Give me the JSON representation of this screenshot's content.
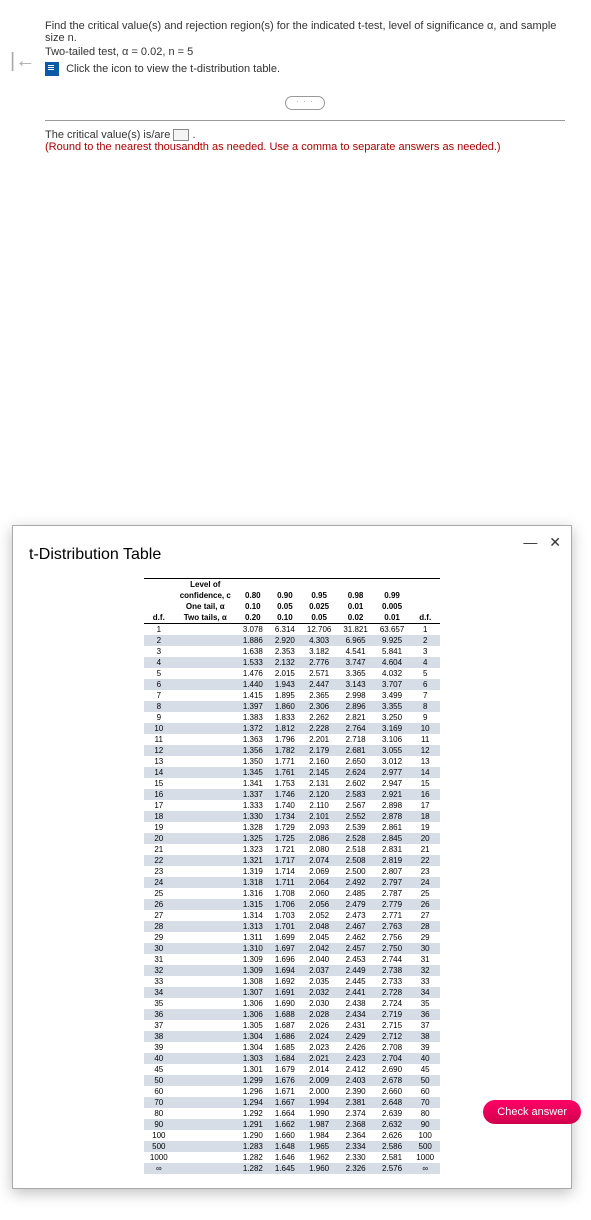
{
  "top": {
    "prompt": "Find the critical value(s) and rejection region(s) for the indicated t-test, level of significance α, and sample size n.",
    "test_line": "Two-tailed test, α = 0.02, n = 5",
    "link_text": "Click the icon to view the t-distribution table."
  },
  "answer": {
    "line1_a": "The critical value(s) is/are ",
    "line1_b": ".",
    "hint": "(Round to the nearest thousandth as needed. Use a comma to separate answers as needed.)"
  },
  "modal": {
    "title": "t-Distribution Table",
    "group_label": "Level of",
    "hdr_conf": "confidence, c",
    "hdr_one": "One tail, α",
    "hdr_two": "Two tails, α",
    "df_label": "d.f.",
    "conf": [
      "0.80",
      "0.90",
      "0.95",
      "0.98",
      "0.99"
    ],
    "one": [
      "0.10",
      "0.05",
      "0.025",
      "0.01",
      "0.005"
    ],
    "two": [
      "0.20",
      "0.10",
      "0.05",
      "0.02",
      "0.01"
    ],
    "rows": [
      {
        "df": "1",
        "v": [
          "3.078",
          "6.314",
          "12.706",
          "31.821",
          "63.657"
        ]
      },
      {
        "df": "2",
        "v": [
          "1.886",
          "2.920",
          "4.303",
          "6.965",
          "9.925"
        ]
      },
      {
        "df": "3",
        "v": [
          "1.638",
          "2.353",
          "3.182",
          "4.541",
          "5.841"
        ]
      },
      {
        "df": "4",
        "v": [
          "1.533",
          "2.132",
          "2.776",
          "3.747",
          "4.604"
        ]
      },
      {
        "df": "5",
        "v": [
          "1.476",
          "2.015",
          "2.571",
          "3.365",
          "4.032"
        ]
      },
      {
        "df": "6",
        "v": [
          "1.440",
          "1.943",
          "2.447",
          "3.143",
          "3.707"
        ]
      },
      {
        "df": "7",
        "v": [
          "1.415",
          "1.895",
          "2.365",
          "2.998",
          "3.499"
        ]
      },
      {
        "df": "8",
        "v": [
          "1.397",
          "1.860",
          "2.306",
          "2.896",
          "3.355"
        ]
      },
      {
        "df": "9",
        "v": [
          "1.383",
          "1.833",
          "2.262",
          "2.821",
          "3.250"
        ]
      },
      {
        "df": "10",
        "v": [
          "1.372",
          "1.812",
          "2.228",
          "2.764",
          "3.169"
        ]
      },
      {
        "df": "11",
        "v": [
          "1.363",
          "1.796",
          "2.201",
          "2.718",
          "3.106"
        ]
      },
      {
        "df": "12",
        "v": [
          "1.356",
          "1.782",
          "2.179",
          "2.681",
          "3.055"
        ]
      },
      {
        "df": "13",
        "v": [
          "1.350",
          "1.771",
          "2.160",
          "2.650",
          "3.012"
        ]
      },
      {
        "df": "14",
        "v": [
          "1.345",
          "1.761",
          "2.145",
          "2.624",
          "2.977"
        ]
      },
      {
        "df": "15",
        "v": [
          "1.341",
          "1.753",
          "2.131",
          "2.602",
          "2.947"
        ]
      },
      {
        "df": "16",
        "v": [
          "1.337",
          "1.746",
          "2.120",
          "2.583",
          "2.921"
        ]
      },
      {
        "df": "17",
        "v": [
          "1.333",
          "1.740",
          "2.110",
          "2.567",
          "2.898"
        ]
      },
      {
        "df": "18",
        "v": [
          "1.330",
          "1.734",
          "2.101",
          "2.552",
          "2.878"
        ]
      },
      {
        "df": "19",
        "v": [
          "1.328",
          "1.729",
          "2.093",
          "2.539",
          "2.861"
        ]
      },
      {
        "df": "20",
        "v": [
          "1.325",
          "1.725",
          "2.086",
          "2.528",
          "2.845"
        ]
      },
      {
        "df": "21",
        "v": [
          "1.323",
          "1.721",
          "2.080",
          "2.518",
          "2.831"
        ]
      },
      {
        "df": "22",
        "v": [
          "1.321",
          "1.717",
          "2.074",
          "2.508",
          "2.819"
        ]
      },
      {
        "df": "23",
        "v": [
          "1.319",
          "1.714",
          "2.069",
          "2.500",
          "2.807"
        ]
      },
      {
        "df": "24",
        "v": [
          "1.318",
          "1.711",
          "2.064",
          "2.492",
          "2.797"
        ]
      },
      {
        "df": "25",
        "v": [
          "1.316",
          "1.708",
          "2.060",
          "2.485",
          "2.787"
        ]
      },
      {
        "df": "26",
        "v": [
          "1.315",
          "1.706",
          "2.056",
          "2.479",
          "2.779"
        ]
      },
      {
        "df": "27",
        "v": [
          "1.314",
          "1.703",
          "2.052",
          "2.473",
          "2.771"
        ]
      },
      {
        "df": "28",
        "v": [
          "1.313",
          "1.701",
          "2.048",
          "2.467",
          "2.763"
        ]
      },
      {
        "df": "29",
        "v": [
          "1.311",
          "1.699",
          "2.045",
          "2.462",
          "2.756"
        ]
      },
      {
        "df": "30",
        "v": [
          "1.310",
          "1.697",
          "2.042",
          "2.457",
          "2.750"
        ]
      },
      {
        "df": "31",
        "v": [
          "1.309",
          "1.696",
          "2.040",
          "2.453",
          "2.744"
        ]
      },
      {
        "df": "32",
        "v": [
          "1.309",
          "1.694",
          "2.037",
          "2.449",
          "2.738"
        ]
      },
      {
        "df": "33",
        "v": [
          "1.308",
          "1.692",
          "2.035",
          "2.445",
          "2.733"
        ]
      },
      {
        "df": "34",
        "v": [
          "1.307",
          "1.691",
          "2.032",
          "2.441",
          "2.728"
        ]
      },
      {
        "df": "35",
        "v": [
          "1.306",
          "1.690",
          "2.030",
          "2.438",
          "2.724"
        ]
      },
      {
        "df": "36",
        "v": [
          "1.306",
          "1.688",
          "2.028",
          "2.434",
          "2.719"
        ]
      },
      {
        "df": "37",
        "v": [
          "1.305",
          "1.687",
          "2.026",
          "2.431",
          "2.715"
        ]
      },
      {
        "df": "38",
        "v": [
          "1.304",
          "1.686",
          "2.024",
          "2.429",
          "2.712"
        ]
      },
      {
        "df": "39",
        "v": [
          "1.304",
          "1.685",
          "2.023",
          "2.426",
          "2.708"
        ]
      },
      {
        "df": "40",
        "v": [
          "1.303",
          "1.684",
          "2.021",
          "2.423",
          "2.704"
        ]
      },
      {
        "df": "45",
        "v": [
          "1.301",
          "1.679",
          "2.014",
          "2.412",
          "2.690"
        ]
      },
      {
        "df": "50",
        "v": [
          "1.299",
          "1.676",
          "2.009",
          "2.403",
          "2.678"
        ]
      },
      {
        "df": "60",
        "v": [
          "1.296",
          "1.671",
          "2.000",
          "2.390",
          "2.660"
        ]
      },
      {
        "df": "70",
        "v": [
          "1.294",
          "1.667",
          "1.994",
          "2.381",
          "2.648"
        ]
      },
      {
        "df": "80",
        "v": [
          "1.292",
          "1.664",
          "1.990",
          "2.374",
          "2.639"
        ]
      },
      {
        "df": "90",
        "v": [
          "1.291",
          "1.662",
          "1.987",
          "2.368",
          "2.632"
        ]
      },
      {
        "df": "100",
        "v": [
          "1.290",
          "1.660",
          "1.984",
          "2.364",
          "2.626"
        ]
      },
      {
        "df": "500",
        "v": [
          "1.283",
          "1.648",
          "1.965",
          "2.334",
          "2.586"
        ]
      },
      {
        "df": "1000",
        "v": [
          "1.282",
          "1.646",
          "1.962",
          "2.330",
          "2.581"
        ]
      },
      {
        "df": "∞",
        "v": [
          "1.282",
          "1.645",
          "1.960",
          "2.326",
          "2.576"
        ]
      }
    ]
  },
  "check_label": "Check answer"
}
